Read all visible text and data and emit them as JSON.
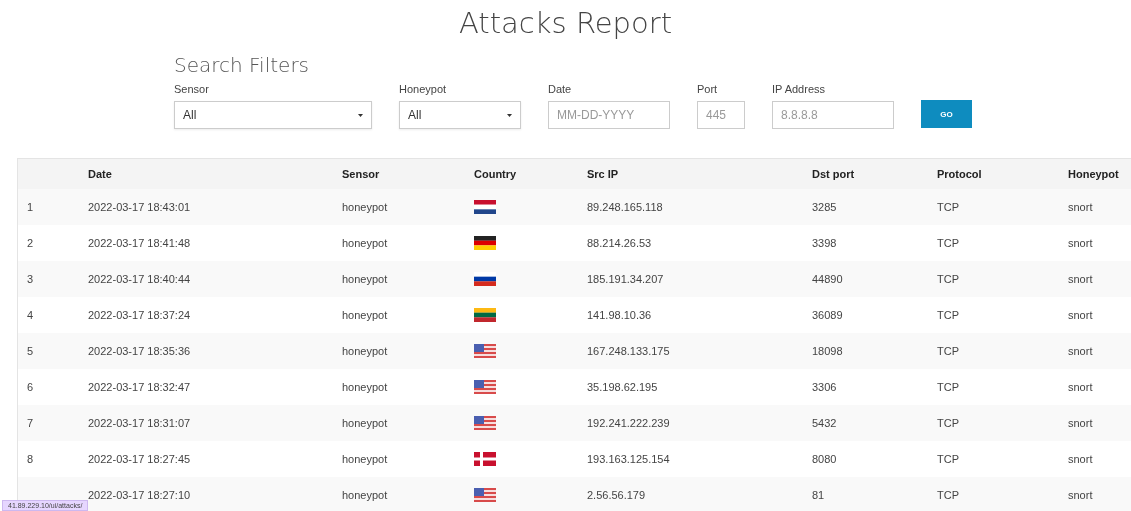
{
  "title": "Attacks Report",
  "filters": {
    "title": "Search Filters",
    "fields": [
      {
        "kind": "select",
        "label": "Sensor",
        "value": "All"
      },
      {
        "kind": "select",
        "label": "Honeypot",
        "value": "All"
      },
      {
        "kind": "input",
        "label": "Date",
        "placeholder": "MM-DD-YYYY"
      },
      {
        "kind": "input",
        "label": "Port",
        "placeholder": "445"
      },
      {
        "kind": "input",
        "label": "IP Address",
        "placeholder": "8.8.8.8"
      }
    ],
    "button": "GO"
  },
  "table": {
    "columns": [
      "Date",
      "Sensor",
      "Country",
      "Src IP",
      "Dst port",
      "Protocol",
      "Honeypot"
    ],
    "rows": [
      {
        "number": "1",
        "date": "2022-03-17 18:43:01",
        "sensor": "honeypot",
        "kind": "nl",
        "src_ip": "89.248.165.118",
        "dst_port": "3285",
        "protocol": "TCP",
        "honeypot": "snort"
      },
      {
        "number": "2",
        "date": "2022-03-17 18:41:48",
        "sensor": "honeypot",
        "kind": "de",
        "src_ip": "88.214.26.53",
        "dst_port": "3398",
        "protocol": "TCP",
        "honeypot": "snort"
      },
      {
        "number": "3",
        "date": "2022-03-17 18:40:44",
        "sensor": "honeypot",
        "kind": "ru",
        "src_ip": "185.191.34.207",
        "dst_port": "44890",
        "protocol": "TCP",
        "honeypot": "snort"
      },
      {
        "number": "4",
        "date": "2022-03-17 18:37:24",
        "sensor": "honeypot",
        "kind": "lt",
        "src_ip": "141.98.10.36",
        "dst_port": "36089",
        "protocol": "TCP",
        "honeypot": "snort"
      },
      {
        "number": "5",
        "date": "2022-03-17 18:35:36",
        "sensor": "honeypot",
        "kind": "us",
        "src_ip": "167.248.133.175",
        "dst_port": "18098",
        "protocol": "TCP",
        "honeypot": "snort"
      },
      {
        "number": "6",
        "date": "2022-03-17 18:32:47",
        "sensor": "honeypot",
        "kind": "us",
        "src_ip": "35.198.62.195",
        "dst_port": "3306",
        "protocol": "TCP",
        "honeypot": "snort"
      },
      {
        "number": "7",
        "date": "2022-03-17 18:31:07",
        "sensor": "honeypot",
        "kind": "us",
        "src_ip": "192.241.222.239",
        "dst_port": "5432",
        "protocol": "TCP",
        "honeypot": "snort"
      },
      {
        "number": "8",
        "date": "2022-03-17 18:27:45",
        "sensor": "honeypot",
        "kind": "dk",
        "src_ip": "193.163.125.154",
        "dst_port": "8080",
        "protocol": "TCP",
        "honeypot": "snort"
      },
      {
        "date": "2022-03-17 18:27:10",
        "sensor": "honeypot",
        "kind": "us",
        "src_ip": "2.56.56.179",
        "dst_port": "81",
        "protocol": "TCP",
        "honeypot": "snort"
      }
    ]
  },
  "status_link": "41.89.229.10/ui/attacks/"
}
